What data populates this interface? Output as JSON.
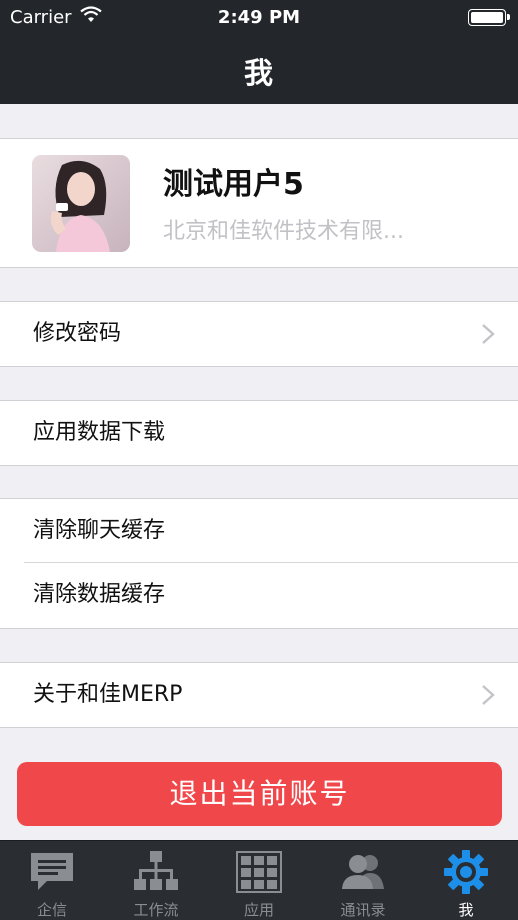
{
  "status_bar": {
    "carrier": "Carrier",
    "time": "2:49 PM"
  },
  "nav": {
    "title": "我"
  },
  "profile": {
    "name": "测试用户5",
    "company": "北京和佳软件技术有限..."
  },
  "menu": {
    "change_password": "修改密码",
    "app_data_download": "应用数据下载",
    "clear_chat_cache": "清除聊天缓存",
    "clear_data_cache": "清除数据缓存",
    "about": "关于和佳MERP"
  },
  "logout_label": "退出当前账号",
  "tabs": [
    {
      "label": "企信",
      "icon": "chat-icon"
    },
    {
      "label": "工作流",
      "icon": "workflow-icon"
    },
    {
      "label": "应用",
      "icon": "apps-grid-icon"
    },
    {
      "label": "通讯录",
      "icon": "contacts-icon"
    },
    {
      "label": "我",
      "icon": "gear-icon",
      "active": true
    }
  ],
  "colors": {
    "accent": "#1e8fe8",
    "logout": "#f0474a",
    "nav_bg": "#23262b"
  }
}
